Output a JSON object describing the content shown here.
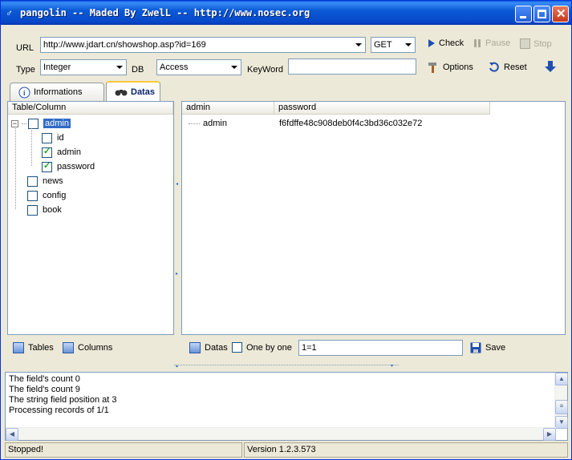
{
  "window": {
    "title": "pangolin -- Maded By ZwelL -- http://www.nosec.org"
  },
  "toolbar": {
    "url_label": "URL",
    "url_value": "http://www.jdart.cn/showshop.asp?id=169",
    "method_value": "GET",
    "check_label": "Check",
    "pause_label": "Pause",
    "stop_label": "Stop",
    "type_label": "Type",
    "type_value": "Integer",
    "db_label": "DB",
    "db_value": "Access",
    "keyword_label": "KeyWord",
    "keyword_value": "",
    "options_label": "Options",
    "reset_label": "Reset"
  },
  "tabs": [
    {
      "label": "Informations",
      "active": false
    },
    {
      "label": "Datas",
      "active": true
    }
  ],
  "tree": {
    "header": "Table/Column",
    "items": [
      {
        "label": "admin",
        "checked": false,
        "selected": true,
        "level": 0
      },
      {
        "label": "id",
        "checked": false,
        "level": 1
      },
      {
        "label": "admin",
        "checked": true,
        "level": 1
      },
      {
        "label": "password",
        "checked": true,
        "level": 1
      },
      {
        "label": "news",
        "checked": false,
        "level": 0
      },
      {
        "label": "config",
        "checked": false,
        "level": 0
      },
      {
        "label": "book",
        "checked": false,
        "level": 0
      }
    ],
    "tables_label": "Tables",
    "columns_label": "Columns"
  },
  "grid": {
    "columns": [
      "admin",
      "password"
    ],
    "rows": [
      [
        "admin",
        "f6fdffe48c908deb0f4c3bd36c032e72"
      ]
    ],
    "datas_label": "Datas",
    "one_by_one_label": "One by one",
    "condition_value": "1=1",
    "save_label": "Save"
  },
  "log": [
    "The field's count 0",
    "The field's count 9",
    "The string field position at 3",
    "Processing records of 1/1"
  ],
  "status": {
    "state": "Stopped!",
    "version": "Version 1.2.3.573"
  },
  "colors": {
    "accent": "#316ac5",
    "titlebar": "#0a5ad6"
  }
}
